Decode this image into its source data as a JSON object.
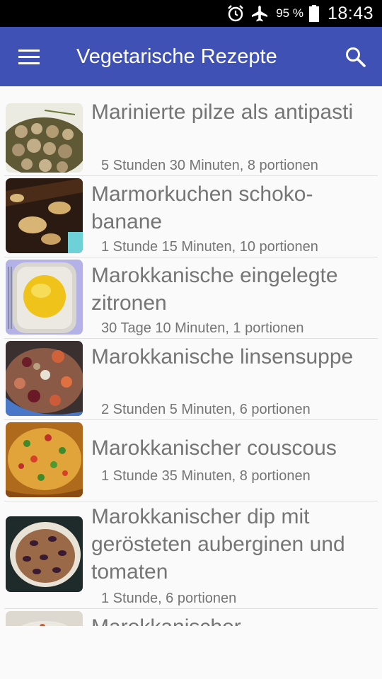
{
  "status_bar": {
    "battery_percent": "95 %",
    "time": "18:43",
    "icons": [
      "alarm-icon",
      "airplane-mode-icon",
      "battery-icon"
    ]
  },
  "app_bar": {
    "title": "Vegetarische Rezepte",
    "color": "#3f51b5",
    "icons": [
      "menu-icon",
      "search-icon"
    ]
  },
  "recipes": [
    {
      "title": "Marinierte pilze als antipasti",
      "meta": "5 Stunden 30 Minuten, 8 portionen"
    },
    {
      "title": "Marmorkuchen schoko-banane",
      "meta": "1 Stunde 15 Minuten, 10 portionen"
    },
    {
      "title": "Marokkanische eingelegte zitronen",
      "meta": "30 Tage 10 Minuten, 1 portionen"
    },
    {
      "title": "Marokkanische linsensuppe",
      "meta": "2 Stunden 5 Minuten, 6 portionen"
    },
    {
      "title": "Marokkanischer couscous",
      "meta": "1 Stunde 35 Minuten, 8 portionen"
    },
    {
      "title": "Marokkanischer dip mit gerösteten auberginen und tomaten",
      "meta": "1 Stunde, 6 portionen"
    },
    {
      "title": "Marokkanischer",
      "meta": ""
    }
  ]
}
